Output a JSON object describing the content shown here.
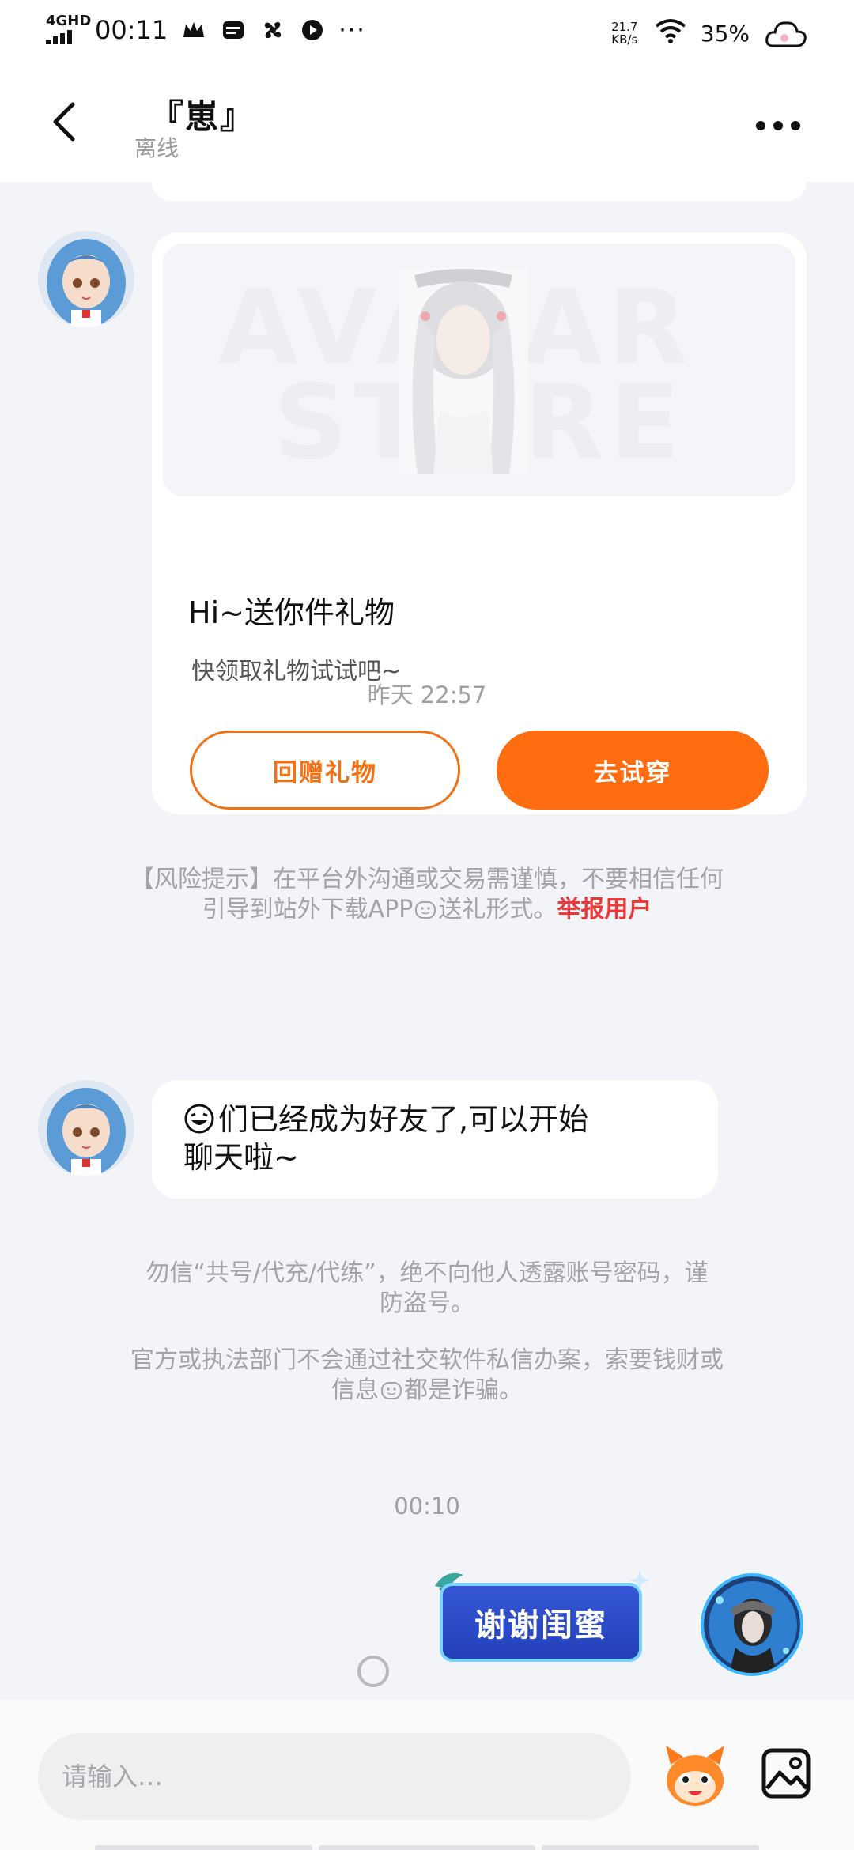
{
  "status_bar": {
    "network": "4GHD",
    "time": "00:11",
    "speed_value": "21.7",
    "speed_unit": "KB/s",
    "battery": "35%"
  },
  "header": {
    "title": "『崽』",
    "status": "离线"
  },
  "gift_card": {
    "watermark_1": "AVATAR",
    "watermark_2": "STORE",
    "title": "Hi~送你件礼物",
    "subtitle": "快领取礼物试试吧~",
    "return_gift_label": "回赠礼物",
    "try_on_label": "去试穿"
  },
  "risk_notice": {
    "text_line1": "【风险提示】在平台外沟通或交易需谨慎，不要相信任何",
    "text_line2_pre": "引导到站外下载APP",
    "text_line2_post": "送礼形式。",
    "report_link": "举报用户"
  },
  "timestamp_1": "昨天 22:57",
  "friend_message": {
    "line1": "们已经成为好友了,可以开始",
    "line2": "聊天啦~"
  },
  "safety_notice_1": {
    "line1": "勿信“共号/代充/代练”，绝不向他人透露账号密码，谨",
    "line2": "防盗号。"
  },
  "safety_notice_2": {
    "line1": "官方或执法部门不会通过社交软件私信办案，索要钱财或",
    "line2_pre": "信息",
    "line2_post": "都是诈骗。"
  },
  "timestamp_2": "00:10",
  "sticker_text": "谢谢闺蜜",
  "input": {
    "placeholder": "请输入…"
  },
  "colors": {
    "accent_orange": "#ff6d10",
    "report_red": "#ec3a3a",
    "background": "#f3f4f8"
  },
  "icons": [
    "back-arrow-icon",
    "more-dots-icon",
    "emoji-mascot-icon",
    "image-picker-icon",
    "wifi-icon",
    "cloud-icon"
  ]
}
